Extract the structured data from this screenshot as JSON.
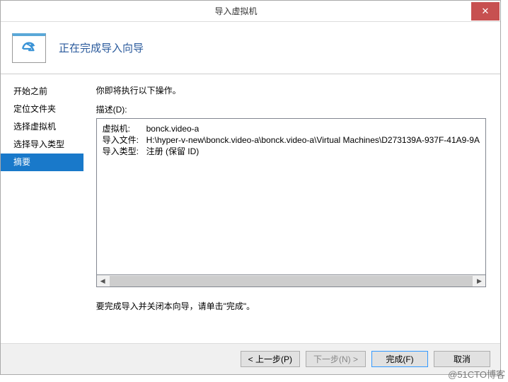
{
  "window": {
    "title": "导入虚拟机",
    "close_glyph": "✕"
  },
  "header": {
    "title": "正在完成导入向导"
  },
  "sidebar": {
    "items": [
      {
        "label": "开始之前"
      },
      {
        "label": "定位文件夹"
      },
      {
        "label": "选择虚拟机"
      },
      {
        "label": "选择导入类型"
      },
      {
        "label": "摘要"
      }
    ],
    "selected_index": 4
  },
  "main": {
    "intro": "你即将执行以下操作。",
    "desc_label": "描述(D):",
    "summary": {
      "vm_key": "虚拟机:",
      "vm_val": "bonck.video-a",
      "file_key": "导入文件:",
      "file_val": "H:\\hyper-v-new\\bonck.video-a\\bonck.video-a\\Virtual Machines\\D273139A-937F-41A9-9A",
      "type_key": "导入类型:",
      "type_val": "注册 (保留 ID)"
    },
    "finish_text": "要完成导入并关闭本向导，请单击\"完成\"。"
  },
  "buttons": {
    "prev": "< 上一步(P)",
    "next": "下一步(N) >",
    "finish": "完成(F)",
    "cancel": "取消"
  },
  "watermark": "@51CTO博客"
}
